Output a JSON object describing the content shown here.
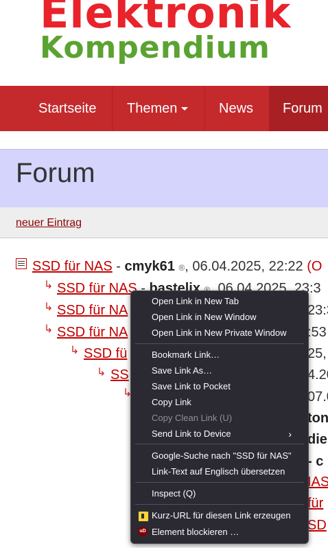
{
  "logo": {
    "line1": "Elektronik",
    "line2": "Kompendium"
  },
  "nav": {
    "items": [
      "Startseite",
      "Themen",
      "News",
      "Forum"
    ]
  },
  "header": {
    "title": "Forum"
  },
  "entrybar": {
    "new_entry": "neuer Eintrag"
  },
  "threads": [
    {
      "title": "SSD für NAS",
      "sep": " - ",
      "author": "cmyk61",
      "reg": "®",
      "date": ", 06.04.2025, 22:22 ",
      "extra": "(O"
    },
    {
      "title": "SSD für NAS",
      "sep": " - ",
      "author": "bastelix",
      "reg": "®",
      "date": ", 06.04.2025, 23:3"
    },
    {
      "title": "SSD für NA",
      "tail": "23:3"
    },
    {
      "title": "SSD für NA",
      "tail": ":53"
    },
    {
      "title": "SSD fü",
      "tail": "25,"
    },
    {
      "title": "SS",
      "tail": "4.20"
    },
    {
      "tail": "07.0"
    }
  ],
  "fragments": [
    "ton",
    "die",
    "- c",
    "IAS",
    "für",
    "SD"
  ],
  "context_menu": {
    "items": [
      "Open Link in New Tab",
      "Open Link in New Window",
      "Open Link in New Private Window",
      "Bookmark Link…",
      "Save Link As…",
      "Save Link to Pocket",
      "Copy Link",
      "Copy Clean Link (U)",
      "Send Link to Device",
      "Google-Suche nach \"SSD für NAS\"",
      "Link-Text auf Englisch übersetzen",
      "Inspect (Q)",
      "Kurz-URL für diesen Link erzeugen",
      "Element blockieren …"
    ],
    "submenu_arrow": "›"
  },
  "colors": {
    "nav": "#c4292c",
    "logo_red": "#e8232b",
    "logo_green": "#5aa332",
    "header_bg": "#d4d4fc",
    "link": "#c00000",
    "menu_bg": "#2b2a33"
  },
  "icons": [
    "doc-icon",
    "reply-arrow-icon",
    "caret-down-icon",
    "chevron-right-icon",
    "shorturl-extension-icon",
    "ublock-icon"
  ]
}
